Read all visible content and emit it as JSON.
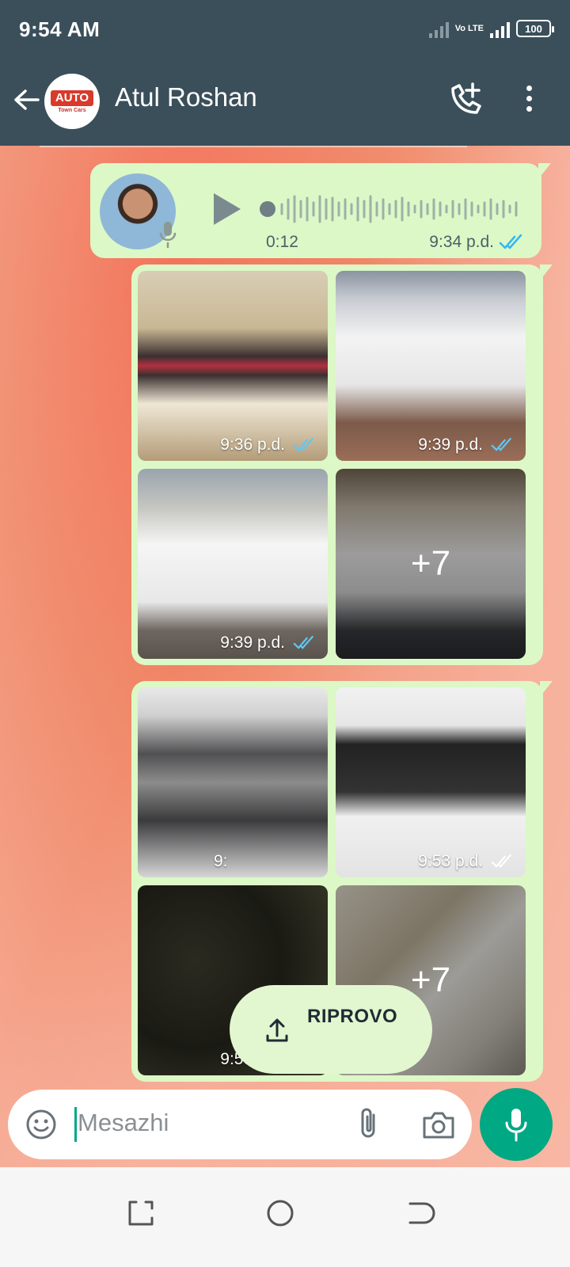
{
  "status_bar": {
    "time": "9:54 AM",
    "network": "Vo LTE",
    "battery": "100"
  },
  "header": {
    "contact_name": "Atul Roshan",
    "avatar_logo_text": "AUTO",
    "avatar_logo_subtext": "Town Cars",
    "icons": [
      "back-arrow-icon",
      "add-call-icon",
      "more-vert-icon"
    ]
  },
  "messages": [
    {
      "type": "voice",
      "duration": "0:12",
      "time": "9:34 p.d.",
      "status": "read"
    },
    {
      "type": "media_group",
      "tiles": [
        {
          "subject": "car interior",
          "time": "9:36 p.d.",
          "status": "read"
        },
        {
          "subject": "car front",
          "time": "9:39 p.d.",
          "status": "read"
        },
        {
          "subject": "car side",
          "time": "9:39 p.d.",
          "status": "read"
        },
        {
          "subject": "car side",
          "more_count": "+7"
        }
      ]
    },
    {
      "type": "media_group",
      "tiles": [
        {
          "subject": "engine bay",
          "time": "9:",
          "status": ""
        },
        {
          "subject": "vehicle label",
          "time": "9:53 p.d.",
          "status": "delivered"
        },
        {
          "subject": "speedometer",
          "time": "9:53 p.d.",
          "status": "sent"
        },
        {
          "subject": "seats",
          "more_count": "+7"
        }
      ]
    }
  ],
  "retry_button": {
    "label": "RIPROVO"
  },
  "composer": {
    "placeholder": "Mesazhi"
  },
  "colors": {
    "header": "#3a4f5a",
    "bubble": "#dcf8c6",
    "accent": "#00a884",
    "tick_read": "#34b7f1"
  }
}
